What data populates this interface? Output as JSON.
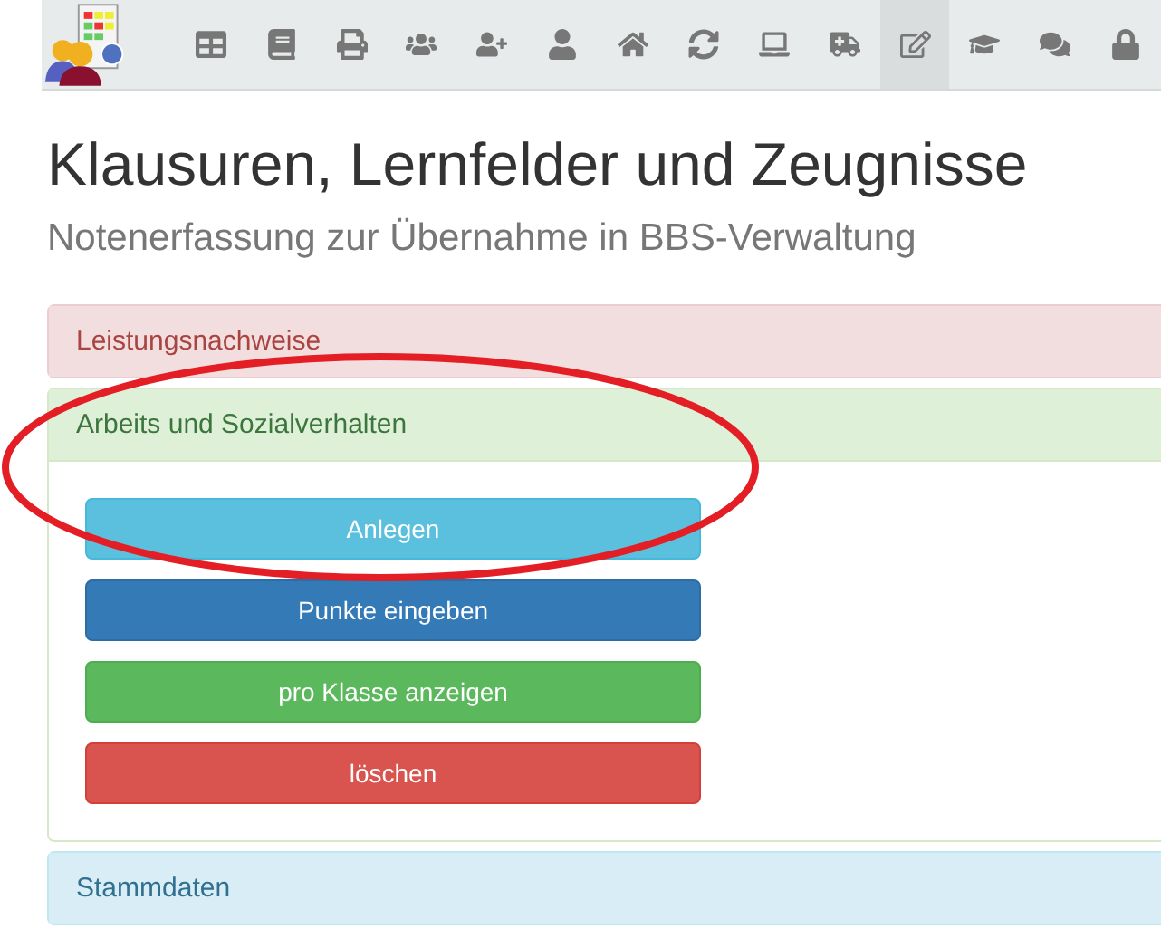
{
  "nav": {
    "items": [
      {
        "kind": "table",
        "selected": false
      },
      {
        "kind": "book",
        "selected": false
      },
      {
        "kind": "print",
        "selected": false
      },
      {
        "kind": "users",
        "selected": false
      },
      {
        "kind": "user-plus",
        "selected": false
      },
      {
        "kind": "user",
        "selected": false
      },
      {
        "kind": "home",
        "selected": false
      },
      {
        "kind": "refresh",
        "selected": false
      },
      {
        "kind": "laptop",
        "selected": false
      },
      {
        "kind": "ambulance",
        "selected": false
      },
      {
        "kind": "edit",
        "selected": true
      },
      {
        "kind": "graduation",
        "selected": false
      },
      {
        "kind": "comments",
        "selected": false
      },
      {
        "kind": "lock",
        "selected": false
      }
    ]
  },
  "title": "Klausuren, Lernfelder und Zeugnisse",
  "subtitle": "Notenerfassung zur Übernahme in BBS-Verwaltung",
  "panels": [
    {
      "heading": "Leistungsnachweise",
      "kind": "danger",
      "expanded": false
    },
    {
      "heading": "Arbeits und Sozialverhalten",
      "kind": "success",
      "expanded": true,
      "buttons": [
        {
          "label": "Anlegen",
          "kind": "info"
        },
        {
          "label": "Punkte eingeben",
          "kind": "primary"
        },
        {
          "label": "pro Klasse anzeigen",
          "kind": "success"
        },
        {
          "label": "löschen",
          "kind": "danger"
        }
      ]
    },
    {
      "heading": "Stammdaten",
      "kind": "info",
      "expanded": false
    }
  ],
  "annotation": {
    "kind": "ellipse",
    "color": "#e31e24"
  }
}
